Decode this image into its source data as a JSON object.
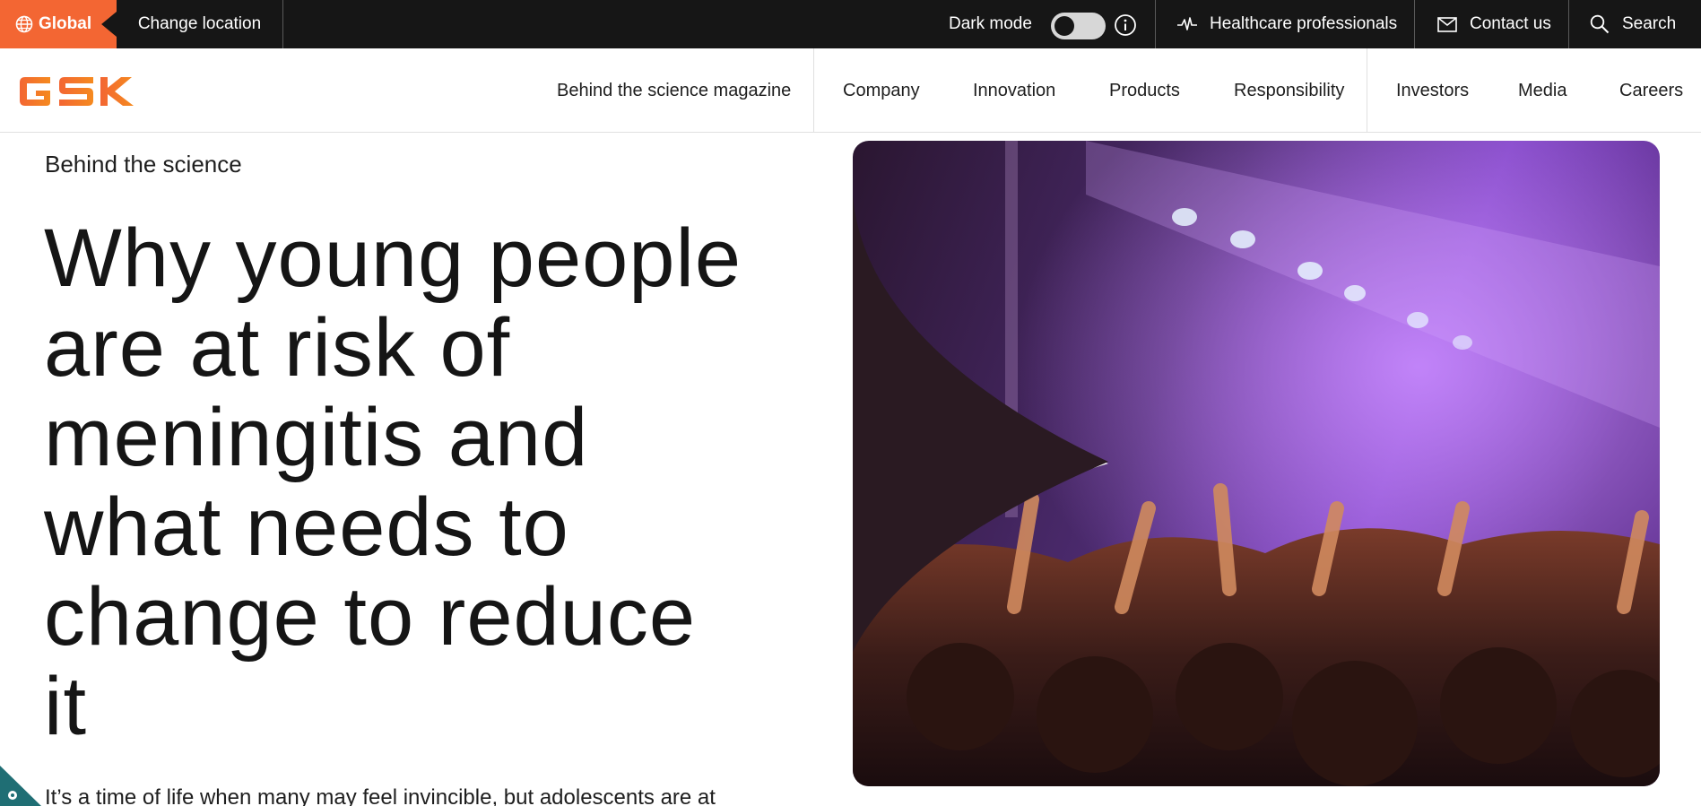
{
  "utility_bar": {
    "global_label": "Global",
    "change_location_label": "Change location",
    "dark_mode_label": "Dark mode",
    "hcp_label": "Healthcare professionals",
    "contact_label": "Contact us",
    "search_label": "Search"
  },
  "brand": {
    "logo_text": "GSK",
    "accent_color": "#f36633"
  },
  "nav": {
    "items": [
      {
        "label": "Behind the science magazine"
      },
      {
        "label": "Company"
      },
      {
        "label": "Innovation"
      },
      {
        "label": "Products"
      },
      {
        "label": "Responsibility"
      },
      {
        "label": "Investors"
      },
      {
        "label": "Media"
      },
      {
        "label": "Careers"
      }
    ]
  },
  "article": {
    "eyebrow": "Behind the science",
    "headline_lines": [
      "Why young people",
      "are at risk of",
      "meningitis and",
      "what needs to",
      "change to reduce",
      "it"
    ],
    "intro": "It’s a time of life when many may feel invincible, but adolescents are at"
  },
  "icons": {
    "globe": "globe-icon",
    "info": "info-icon",
    "pulse": "pulse-icon",
    "mail": "mail-icon",
    "search": "search-icon",
    "cookie": "gear-icon"
  }
}
